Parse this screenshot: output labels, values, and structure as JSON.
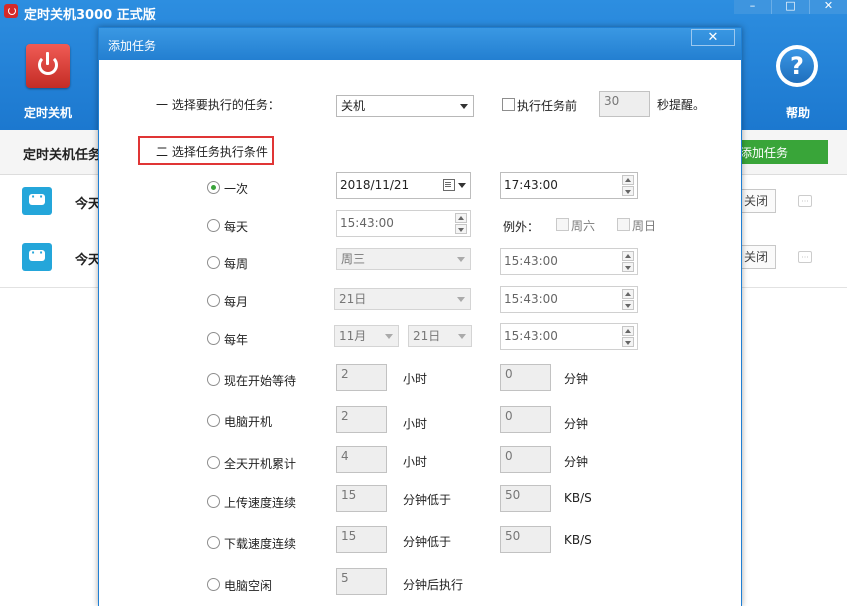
{
  "app": {
    "title": "定时关机3000 正式版",
    "window_controls": {
      "min": "–",
      "max": "□",
      "close": "✕"
    },
    "toolbar": {
      "power_label": "定时关机",
      "help_label": "帮助",
      "help_glyph": "?"
    },
    "subheader": {
      "title": "定时关机任务",
      "add_task_label": "添加任务"
    },
    "tasks": [
      {
        "text": "今天",
        "close_label": "关闭",
        "more": "···"
      },
      {
        "text": "今天",
        "close_label": "关闭",
        "more": "···"
      }
    ]
  },
  "dialog": {
    "title": "添加任务",
    "close_glyph": "✕",
    "section1": {
      "label": "一 选择要执行的任务：",
      "task_select": "关机",
      "remind_check_label": "执行任务前",
      "remind_seconds": "30",
      "remind_suffix": "秒提醒。"
    },
    "section2": {
      "label": "二 选择任务执行条件"
    },
    "conditions": {
      "once": {
        "label": "一次",
        "selected": true,
        "date": "2018/11/21",
        "time": "17:43:00"
      },
      "daily": {
        "label": "每天",
        "time": "15:43:00",
        "except_label": "例外：",
        "sat_label": "周六",
        "sun_label": "周日"
      },
      "weekly": {
        "label": "每周",
        "weekday": "周三",
        "time": "15:43:00"
      },
      "monthly": {
        "label": "每月",
        "day": "21日",
        "time": "15:43:00"
      },
      "yearly": {
        "label": "每年",
        "month": "11月",
        "day": "21日",
        "time": "15:43:00"
      },
      "wait": {
        "label": "现在开始等待",
        "hours": "2",
        "hours_unit": "小时",
        "minutes": "0",
        "minutes_unit": "分钟"
      },
      "boot": {
        "label": "电脑开机",
        "hours": "2",
        "hours_unit": "小时",
        "minutes": "0",
        "minutes_unit": "分钟"
      },
      "daily_total": {
        "label": "全天开机累计",
        "hours": "4",
        "hours_unit": "小时",
        "minutes": "0",
        "minutes_unit": "分钟"
      },
      "upload": {
        "label": "上传速度连续",
        "minutes": "15",
        "minutes_unit": "分钟低于",
        "speed": "50",
        "speed_unit": "KB/S"
      },
      "download": {
        "label": "下载速度连续",
        "minutes": "15",
        "minutes_unit": "分钟低于",
        "speed": "50",
        "speed_unit": "KB/S"
      },
      "idle": {
        "label": "电脑空闲",
        "minutes": "5",
        "minutes_unit": "分钟后执行"
      }
    }
  }
}
